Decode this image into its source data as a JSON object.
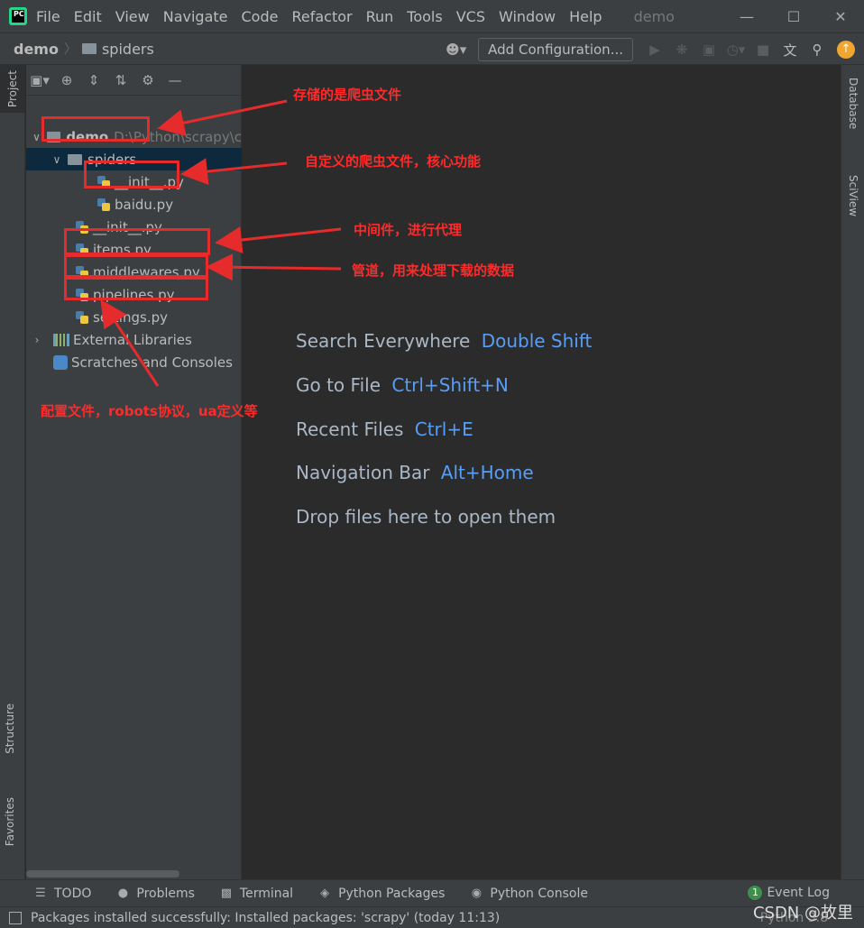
{
  "app": {
    "logo_text": "PC",
    "menu": [
      "File",
      "Edit",
      "View",
      "Navigate",
      "Code",
      "Refactor",
      "Run",
      "Tools",
      "VCS",
      "Window",
      "Help"
    ],
    "window_title": "demo",
    "win_controls": {
      "minimize": "—",
      "maximize": "☐",
      "close": "✕"
    }
  },
  "navbar": {
    "project": "demo",
    "folder": "spiders",
    "add_configuration": "Add Configuration..."
  },
  "left_tabs": {
    "project": "Project",
    "structure": "Structure",
    "favorites": "Favorites"
  },
  "right_tabs": {
    "database": "Database",
    "sciview": "SciView"
  },
  "project_tree": {
    "root_name": "demo",
    "root_path": "D:\\Python\\scrapy\\c",
    "spiders": "spiders",
    "spider_init": "__init__.py",
    "baidu": "baidu.py",
    "init": "__init__.py",
    "items": "items.py",
    "middlewares": "middlewares.py",
    "pipelines": "pipelines.py",
    "settings": "settings.py",
    "external_libraries": "External Libraries",
    "scratches": "Scratches and Consoles"
  },
  "editor_hints": {
    "search_label": "Search Everywhere",
    "search_key": "Double Shift",
    "goto_label": "Go to File",
    "goto_key": "Ctrl+Shift+N",
    "recent_label": "Recent Files",
    "recent_key": "Ctrl+E",
    "navbar_label": "Navigation Bar",
    "navbar_key": "Alt+Home",
    "drop_label": "Drop files here to open them"
  },
  "bottom_tabs": {
    "todo": "TODO",
    "problems": "Problems",
    "terminal": "Terminal",
    "python_packages": "Python Packages",
    "python_console": "Python Console",
    "event_log": "Event Log",
    "event_count": "1"
  },
  "status": {
    "message": "Packages installed successfully: Installed packages: 'scrapy' (today 11:13)",
    "interpreter": "Python 3.8",
    "watermark": "CSDN @故里"
  },
  "annotations": {
    "spiders_note": "存储的是爬虫文件",
    "baidu_note": "自定义的爬虫文件，核心功能",
    "middlewares_note": "中间件，进行代理",
    "pipelines_note": "管道，用来处理下载的数据",
    "settings_note": "配置文件，robots协议，ua定义等"
  },
  "colors": {
    "annotation": "#e52b2b",
    "shortcut": "#589df6",
    "selection": "#0d293e",
    "background": "#2b2b2b",
    "chrome": "#3c3f41"
  }
}
